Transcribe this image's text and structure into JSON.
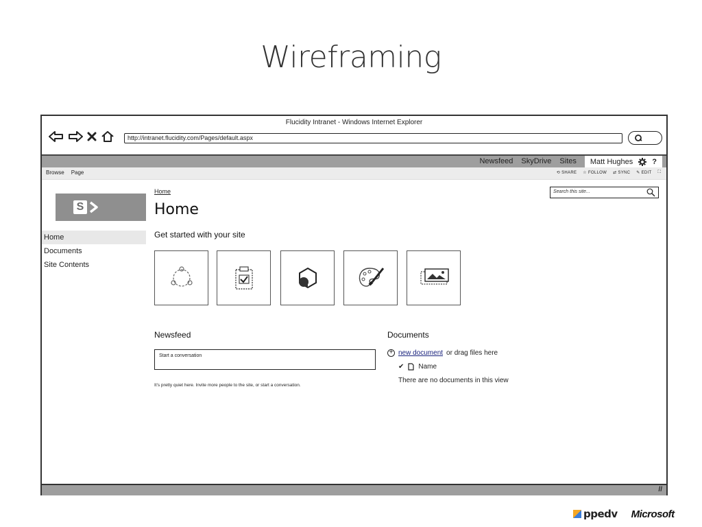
{
  "slide": {
    "title": "Wireframing"
  },
  "window": {
    "title": "Flucidity Intranet - Windows Internet Explorer",
    "address": "http://intranet.flucidity.com/Pages/default.aspx"
  },
  "suite_bar": {
    "links": [
      "Newsfeed",
      "SkyDrive",
      "Sites"
    ],
    "user": "Matt Hughes",
    "help": "?"
  },
  "ribbon": {
    "tabs": [
      "Browse",
      "Page"
    ],
    "actions": [
      "SHARE",
      "FOLLOW",
      "SYNC",
      "EDIT"
    ]
  },
  "site": {
    "breadcrumb": "Home",
    "page_title": "Home",
    "search_placeholder": "Search this site..."
  },
  "left_nav": [
    "Home",
    "Documents",
    "Site Contents"
  ],
  "get_started": {
    "heading": "Get started with your site",
    "tiles": [
      "share-site-icon",
      "task-list-icon",
      "apps-icon",
      "theme-palette-icon",
      "image-icon"
    ]
  },
  "newsfeed": {
    "heading": "Newsfeed",
    "conversation_placeholder": "Start a conversation",
    "quiet_message": "It's pretty quiet here. Invite more people to the site, or start a conversation."
  },
  "documents": {
    "heading": "Documents",
    "new_link": "new document",
    "drag_text": "or drag files here",
    "column_name": "Name",
    "empty_message": "There are no documents in this view"
  },
  "footer": {
    "logo_left": "ppedv",
    "logo_right": "Microsoft"
  }
}
